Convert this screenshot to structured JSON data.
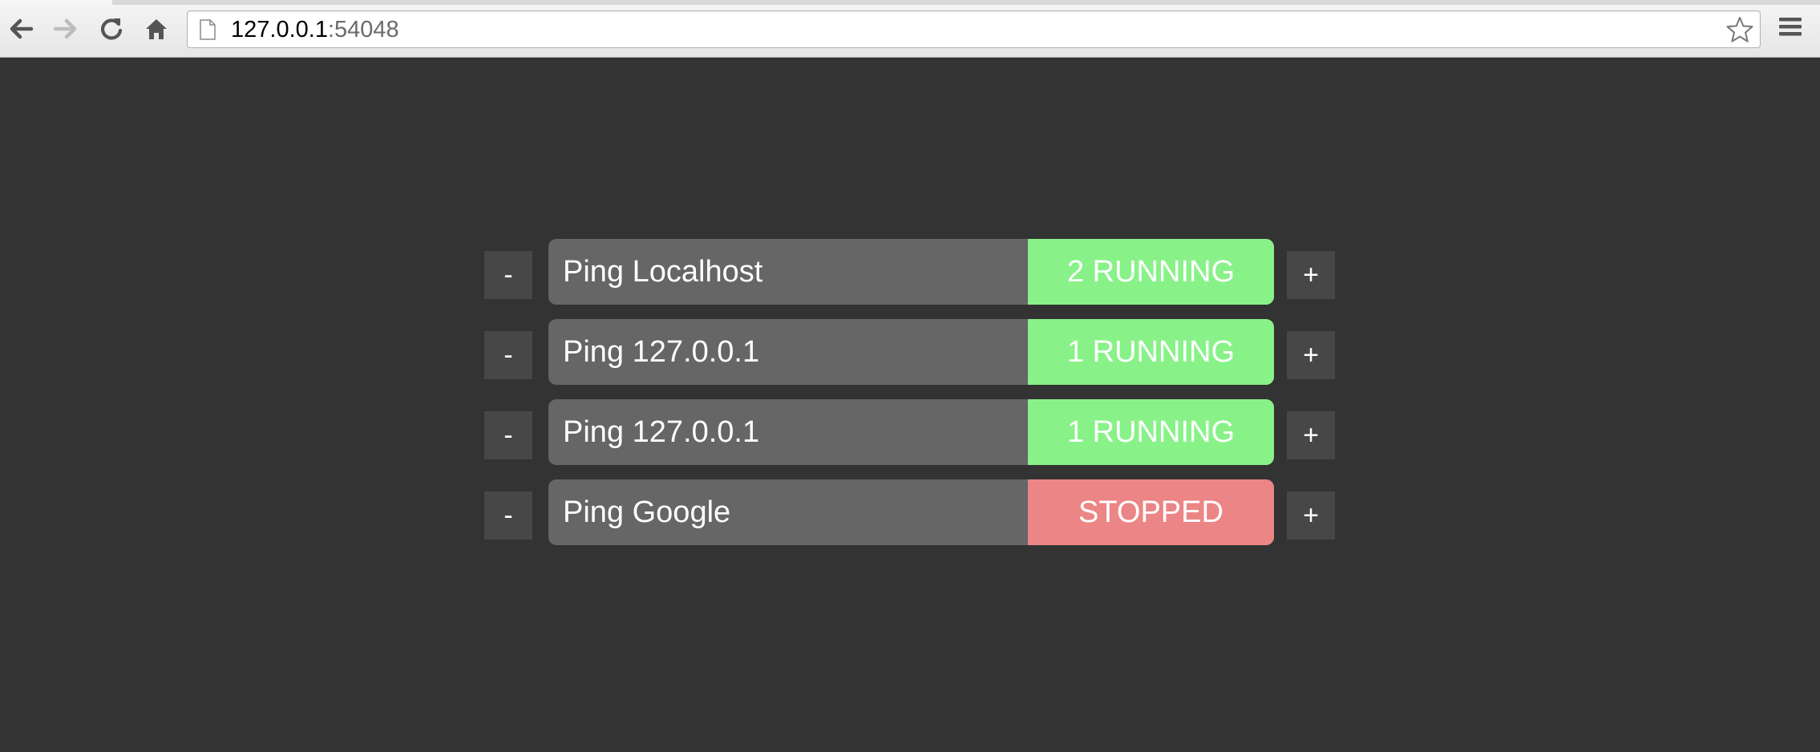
{
  "browser": {
    "url_host": "127.0.0.1",
    "url_port": ":54048",
    "icons": {
      "back": "back-arrow-icon",
      "forward": "forward-arrow-icon",
      "reload": "reload-icon",
      "home": "home-icon",
      "page": "page-icon",
      "bookmark": "star-icon",
      "menu": "hamburger-menu-icon"
    }
  },
  "colors": {
    "background": "#333333",
    "pill": "#666666",
    "side_button": "#474747",
    "running": "#88f288",
    "stopped": "#ec8585"
  },
  "processes": [
    {
      "name": "Ping Localhost",
      "status": "2 RUNNING",
      "state": "running",
      "minus_label": "-",
      "plus_label": "+"
    },
    {
      "name": "Ping 127.0.0.1",
      "status": "1 RUNNING",
      "state": "running",
      "minus_label": "-",
      "plus_label": "+"
    },
    {
      "name": "Ping 127.0.0.1",
      "status": "1 RUNNING",
      "state": "running",
      "minus_label": "-",
      "plus_label": "+"
    },
    {
      "name": "Ping Google",
      "status": "STOPPED",
      "state": "stopped",
      "minus_label": "-",
      "plus_label": "+"
    }
  ]
}
